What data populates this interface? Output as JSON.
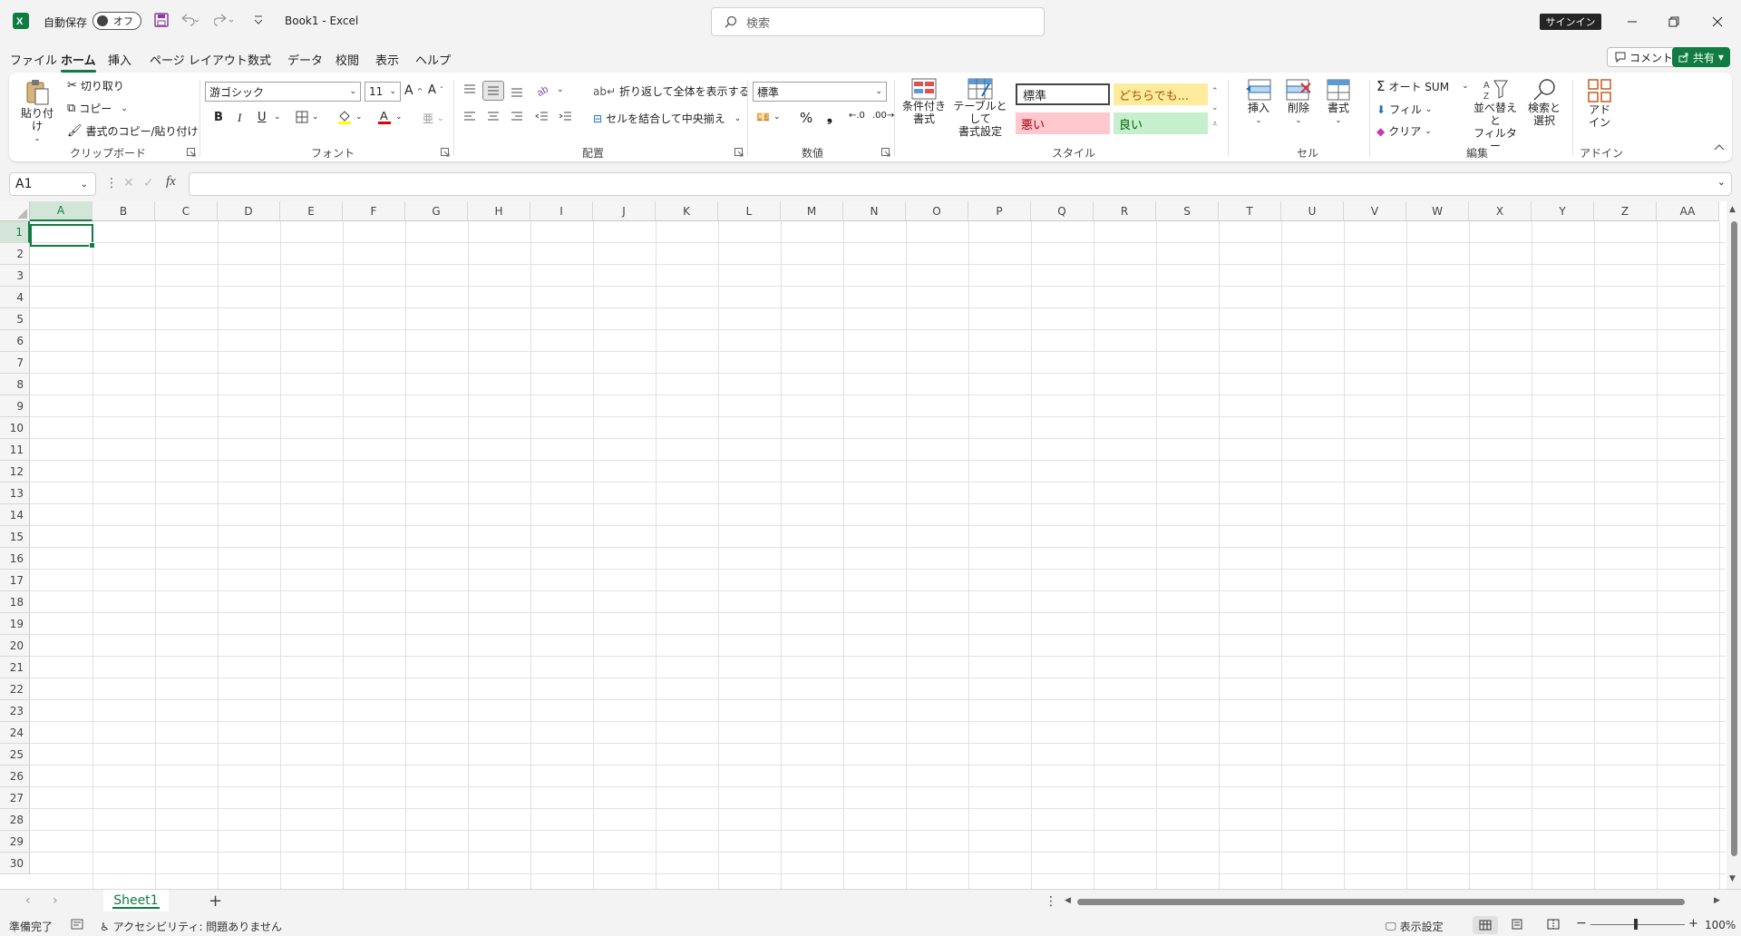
{
  "titlebar": {
    "autosave_label": "自動保存",
    "autosave_state": "オフ",
    "doc_title": "Book1 - Excel",
    "search_placeholder": "検索",
    "signin_label": "サインイン"
  },
  "menu": {
    "items": [
      "ファイル",
      "ホーム",
      "挿入",
      "ページ レイアウト",
      "数式",
      "データ",
      "校閲",
      "表示",
      "ヘルプ"
    ],
    "active_index": 1,
    "comment_label": "コメント",
    "share_label": "共有"
  },
  "ribbon": {
    "clipboard": {
      "label": "クリップボード",
      "paste": "貼り付け",
      "cut": "切り取り",
      "copy": "コピー",
      "format_painter": "書式のコピー/貼り付け"
    },
    "font": {
      "label": "フォント",
      "font_name": "游ゴシック",
      "font_size": "11",
      "bold": "B",
      "italic": "I",
      "underline": "U"
    },
    "alignment": {
      "label": "配置",
      "wrap_text": "折り返して全体を表示する",
      "merge_center": "セルを結合して中央揃え"
    },
    "number": {
      "label": "数値",
      "format": "標準",
      "percent": "%",
      "comma": "❟"
    },
    "styles": {
      "label": "スタイル",
      "conditional": "条件付き\n書式",
      "table": "テーブルとして\n書式設定",
      "normal": "標準",
      "neutral": "どちらでも...",
      "bad": "悪い",
      "good": "良い",
      "neutral_bg": "#ffeb9c",
      "neutral_fg": "#9c5700",
      "bad_bg": "#ffc7ce",
      "bad_fg": "#9c0006",
      "good_bg": "#c6efce",
      "good_fg": "#006100"
    },
    "cells": {
      "label": "セル",
      "insert": "挿入",
      "delete": "削除",
      "format": "書式"
    },
    "editing": {
      "label": "編集",
      "autosum": "オート SUM",
      "fill": "フィル",
      "clear": "クリア",
      "sort_filter": "並べ替えと\nフィルター",
      "find_select": "検索と\n選択"
    },
    "addins": {
      "label": "アドイン",
      "addin": "アド\nイン"
    }
  },
  "formula_bar": {
    "name_box": "A1",
    "fx": "fx",
    "value": ""
  },
  "grid": {
    "columns": [
      "A",
      "B",
      "C",
      "D",
      "E",
      "F",
      "G",
      "H",
      "I",
      "J",
      "K",
      "L",
      "M",
      "N",
      "O",
      "P",
      "Q",
      "R",
      "S",
      "T",
      "U",
      "V",
      "W",
      "X",
      "Y",
      "Z",
      "AA"
    ],
    "rows": [
      "1",
      "2",
      "3",
      "4",
      "5",
      "6",
      "7",
      "8",
      "9",
      "10",
      "11",
      "12",
      "13",
      "14",
      "15",
      "16",
      "17",
      "18",
      "19",
      "20",
      "21",
      "22",
      "23",
      "24",
      "25",
      "26",
      "27",
      "28",
      "29",
      "30"
    ],
    "active_column": "A",
    "active_row": "1"
  },
  "sheets": {
    "tabs": [
      "Sheet1"
    ],
    "active": "Sheet1",
    "add_label": "+"
  },
  "status": {
    "ready": "準備完了",
    "accessibility": "アクセシビリティ: 問題ありません",
    "display_settings": "表示設定",
    "zoom": "100%"
  },
  "colors": {
    "accent": "#107c41",
    "grid_line": "#e1e1e1"
  }
}
